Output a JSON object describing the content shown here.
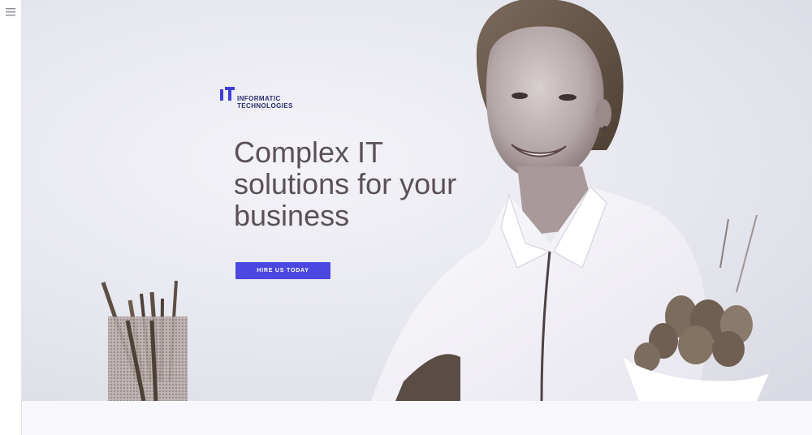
{
  "sidebar": {
    "menu_icon": "hamburger-icon"
  },
  "brand": {
    "mark": "IT",
    "line1": "INFORMATIC",
    "line2": "TECHNOLOGIES",
    "color": "#3f3fd8"
  },
  "hero": {
    "headline_lines": [
      "Complex IT",
      "solutions for your",
      "business"
    ],
    "cta_label": "HIRE US TODAY",
    "cta_color": "#4a48e0"
  }
}
